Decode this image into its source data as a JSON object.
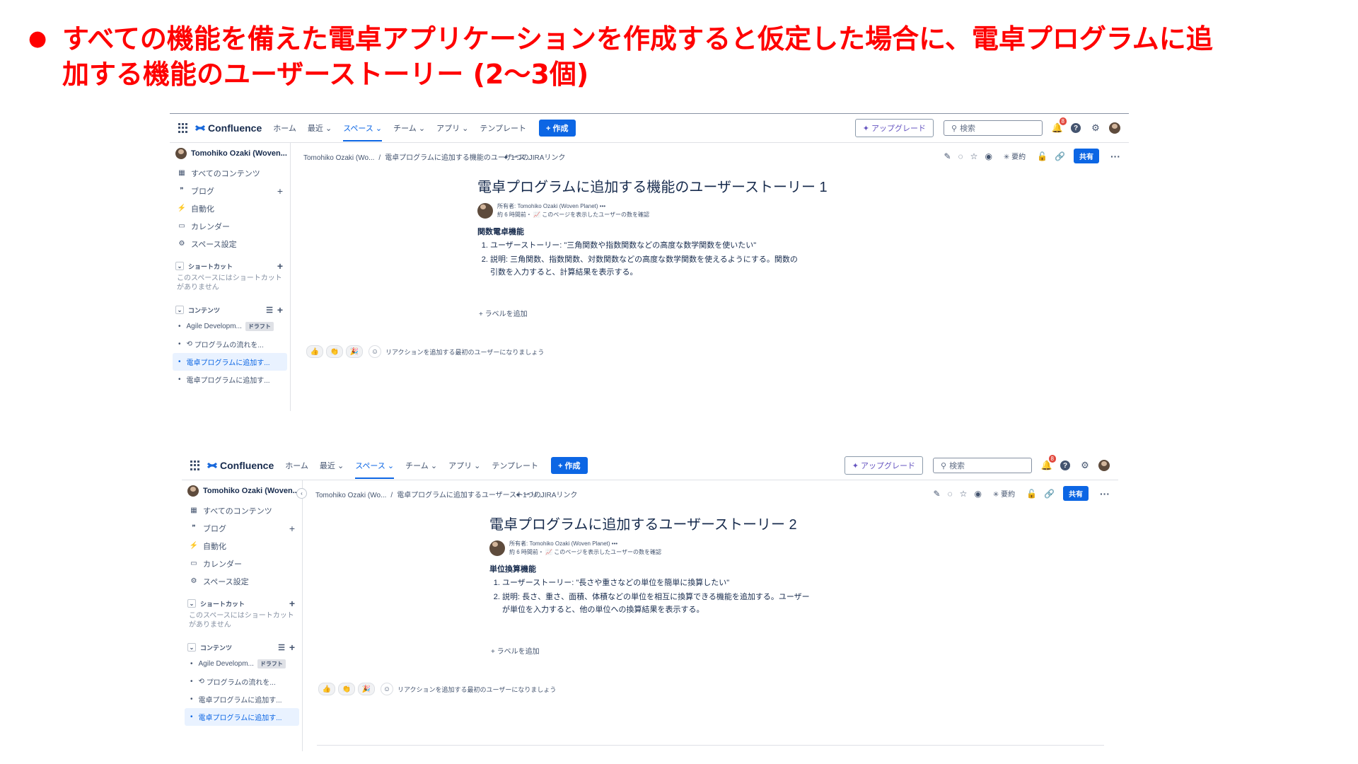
{
  "slide": {
    "bullet": "●",
    "title": "すべての機能を備えた電卓アプリケーションを作成すると仮定した場合に、電卓プログラムに追\n加する機能のユーザーストーリー (2〜3個)"
  },
  "screens": [
    {
      "nav": {
        "brand": "Confluence",
        "items": [
          "ホーム",
          "最近 ⌄",
          "スペース ⌄",
          "チーム ⌄",
          "アプリ ⌄",
          "テンプレート"
        ],
        "create": "+ 作成",
        "upgrade": "✦ アップグレード",
        "search_placeholder": "検索",
        "notification_count": "8"
      },
      "sidebar": {
        "space_name": "Tomohiko Ozaki (Woven...",
        "items": [
          "すべてのコンテンツ",
          "ブログ",
          "自動化",
          "カレンダー",
          "スペース設定"
        ],
        "shortcuts_header": "ショートカット",
        "shortcuts_empty": "このスペースにはショートカットがありません",
        "content_header": "コンテンツ",
        "tree": [
          "Agile Developm...",
          "プログラムの流れを...",
          "電卓プログラムに追加す...",
          "電卓プログラムに追加す..."
        ],
        "draft_label": "ドラフト"
      },
      "breadcrumb": [
        "Tomohiko Ozaki (Wo...",
        "電卓プログラムに追加する機能のユーザース..."
      ],
      "jira_link": "1つのJIRAリンク",
      "actions": {
        "summary": "要約",
        "share": "共有"
      },
      "page": {
        "title": "電卓プログラムに追加する機能のユーザーストーリー 1",
        "owner": "所有者: Tomohiko Ozaki (Woven Planet)  •••",
        "meta": "約 6 時間前・  📈 このページを表示したユーザーの数を確認",
        "section": "関数電卓機能",
        "list": [
          "ユーザーストーリー: \"三角関数や指数関数などの高度な数学関数を使いたい\"",
          "説明: 三角関数、指数関数、対数関数などの高度な数学関数を使えるようにする。関数の引数を入力すると、計算結果を表示する。"
        ],
        "add_label": "+ ラベルを追加",
        "reaction_prompt": "リアクションを追加する最初のユーザーになりましょう"
      }
    },
    {
      "nav": {
        "brand": "Confluence",
        "items": [
          "ホーム",
          "最近 ⌄",
          "スペース ⌄",
          "チーム ⌄",
          "アプリ ⌄",
          "テンプレート"
        ],
        "create": "+ 作成",
        "upgrade": "✦ アップグレード",
        "search_placeholder": "検索",
        "notification_count": "8"
      },
      "sidebar": {
        "space_name": "Tomohiko Ozaki (Woven...",
        "items": [
          "すべてのコンテンツ",
          "ブログ",
          "自動化",
          "カレンダー",
          "スペース設定"
        ],
        "shortcuts_header": "ショートカット",
        "shortcuts_empty": "このスペースにはショートカットがありません",
        "content_header": "コンテンツ",
        "tree": [
          "Agile Developm...",
          "プログラムの流れを...",
          "電卓プログラムに追加す...",
          "電卓プログラムに追加す..."
        ],
        "draft_label": "ドラフト"
      },
      "breadcrumb": [
        "Tomohiko Ozaki (Wo...",
        "電卓プログラムに追加するユーザーストーリ..."
      ],
      "jira_link": "1つのJIRAリンク",
      "actions": {
        "summary": "要約",
        "share": "共有"
      },
      "page": {
        "title": "電卓プログラムに追加するユーザーストーリー 2",
        "owner": "所有者: Tomohiko Ozaki (Woven Planet)  •••",
        "meta": "約 6 時間前・  📈 このページを表示したユーザーの数を確認",
        "section": "単位換算機能",
        "list": [
          "ユーザーストーリー: \"長さや重さなどの単位を簡単に換算したい\"",
          "説明: 長さ、重さ、面積、体積などの単位を相互に換算できる機能を追加する。ユーザーが単位を入力すると、他の単位への換算結果を表示する。"
        ],
        "add_label": "+ ラベルを追加",
        "reaction_prompt": "リアクションを追加する最初のユーザーになりましょう"
      }
    }
  ]
}
